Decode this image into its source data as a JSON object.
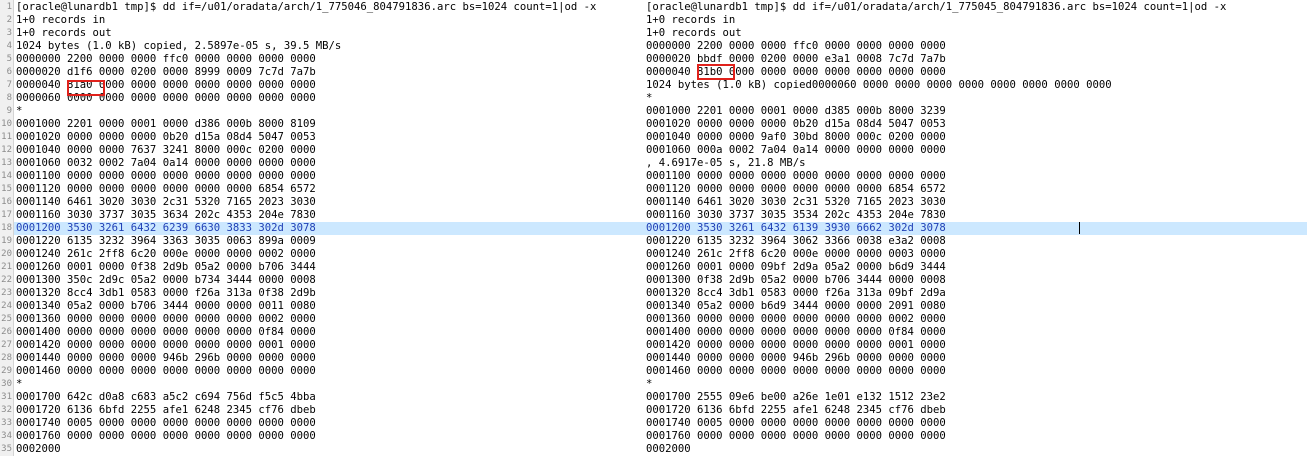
{
  "left_pane": [
    "[oracle@lunardb1 tmp]$ dd if=/u01/oradata/arch/1_775046_804791836.arc bs=1024 count=1|od -x",
    "1+0 records in",
    "1+0 records out",
    "1024 bytes (1.0 kB) copied, 2.5897e-05 s, 39.5 MB/s",
    "0000000 2200 0000 0000 ffc0 0000 0000 0000 0000",
    "0000020 d1f6 0000 0200 0000 8999 0009 7c7d 7a7b",
    "0000040 81a0 0000 0000 0000 0000 0000 0000 0000",
    "0000060 0000 0000 0000 0000 0000 0000 0000 0000",
    "*",
    "0001000 2201 0000 0001 0000 d386 000b 8000 8109",
    "0001020 0000 0000 0000 0b20 d15a 08d4 5047 0053",
    "0001040 0000 0000 7637 3241 8000 000c 0200 0000",
    "0001060 0032 0002 7a04 0a14 0000 0000 0000 0000",
    "0001100 0000 0000 0000 0000 0000 0000 0000 0000",
    "0001120 0000 0000 0000 0000 0000 0000 6854 6572",
    "0001140 6461 3020 3030 2c31 5320 7165 2023 3030",
    "0001160 3030 3737 3035 3634 202c 4353 204e 7830",
    "0001200 3530 3261 6432 6239 6630 3833 302d 3078",
    "0001220 6135 3232 3964 3363 3035 0063 899a 0009",
    "0001240 261c 2ff8 6c20 000e 0000 0000 0002 0000",
    "0001260 0001 0000 0f38 2d9b 05a2 0000 b706 3444",
    "0001300 350c 2d9c 05a2 0000 b734 3444 0000 0008",
    "0001320 8cc4 3db1 0583 0000 f26a 313a 0f38 2d9b",
    "0001340 05a2 0000 b706 3444 0000 0000 0011 0080",
    "0001360 0000 0000 0000 0000 0000 0000 0002 0000",
    "0001400 0000 0000 0000 0000 0000 0000 0f84 0000",
    "0001420 0000 0000 0000 0000 0000 0000 0001 0000",
    "0001440 0000 0000 0000 946b 296b 0000 0000 0000",
    "0001460 0000 0000 0000 0000 0000 0000 0000 0000",
    "*",
    "0001700 642c d0a8 c683 a5c2 c694 756d f5c5 4bba",
    "0001720 6136 6bfd 2255 afe1 6248 2345 cf76 dbeb",
    "0001740 0005 0000 0000 0000 0000 0000 0000 0000",
    "0001760 0000 0000 0000 0000 0000 0000 0000 0000",
    "0002000"
  ],
  "right_pane": [
    "[oracle@lunardb1 tmp]$ dd if=/u01/oradata/arch/1_775045_804791836.arc bs=1024 count=1|od -x",
    "1+0 records in",
    "1+0 records out",
    "0000000 2200 0000 0000 ffc0 0000 0000 0000 0000",
    "0000020 bbdf 0000 0200 0000 e3a1 0008 7c7d 7a7b",
    "0000040 81b0 0000 0000 0000 0000 0000 0000 0000",
    "1024 bytes (1.0 kB) copied0000060 0000 0000 0000 0000 0000 0000 0000 0000",
    "*",
    "0001000 2201 0000 0001 0000 d385 000b 8000 3239",
    "0001020 0000 0000 0000 0b20 d15a 08d4 5047 0053",
    "0001040 0000 0000 9af0 30bd 8000 000c 0200 0000",
    "0001060 000a 0002 7a04 0a14 0000 0000 0000 0000",
    ", 4.6917e-05 s, 21.8 MB/s",
    "0001100 0000 0000 0000 0000 0000 0000 0000 0000",
    "0001120 0000 0000 0000 0000 0000 0000 6854 6572",
    "0001140 6461 3020 3030 2c31 5320 7165 2023 3030",
    "0001160 3030 3737 3035 3534 202c 4353 204e 7830",
    "0001200 3530 3261 6432 6139 3930 6662 302d 3078",
    "0001220 6135 3232 3964 3062 3366 0038 e3a2 0008",
    "0001240 261c 2ff8 6c20 000e 0000 0000 0003 0000",
    "0001260 0001 0000 09bf 2d9a 05a2 0000 b6d9 3444",
    "0001300 0f38 2d9b 05a2 0000 b706 3444 0000 0008",
    "0001320 8cc4 3db1 0583 0000 f26a 313a 09bf 2d9a",
    "0001340 05a2 0000 b6d9 3444 0000 0000 2091 0080",
    "0001360 0000 0000 0000 0000 0000 0000 0002 0000",
    "0001400 0000 0000 0000 0000 0000 0000 0f84 0000",
    "0001420 0000 0000 0000 0000 0000 0000 0001 0000",
    "0001440 0000 0000 0000 946b 296b 0000 0000 0000",
    "0001460 0000 0000 0000 0000 0000 0000 0000 0000",
    "*",
    "0001700 2555 09e6 be00 a26e 1e01 e132 1512 23e2",
    "0001720 6136 6bfd 2255 afe1 6248 2345 cf76 dbeb",
    "0001740 0005 0000 0000 0000 0000 0000 0000 0000",
    "0001760 0000 0000 0000 0000 0000 0000 0000 0000",
    "0002000"
  ],
  "line_numbers": [
    "1",
    "2",
    "3",
    "4",
    "5",
    "6",
    "7",
    "8",
    "9",
    "10",
    "11",
    "12",
    "13",
    "14",
    "15",
    "16",
    "17",
    "18",
    "19",
    "20",
    "21",
    "22",
    "23",
    "24",
    "25",
    "26",
    "27",
    "28",
    "29",
    "30",
    "31",
    "32",
    "33",
    "34",
    "35"
  ],
  "current_line": 18,
  "highlighted_values": {
    "left": "81a0",
    "right": "81b0"
  },
  "colors": {
    "current_line_bg": "#cce8ff",
    "current_line_text": "#1f3fb5",
    "highlight_box": "#e0211b",
    "gutter_bg": "#f0f0f0"
  }
}
